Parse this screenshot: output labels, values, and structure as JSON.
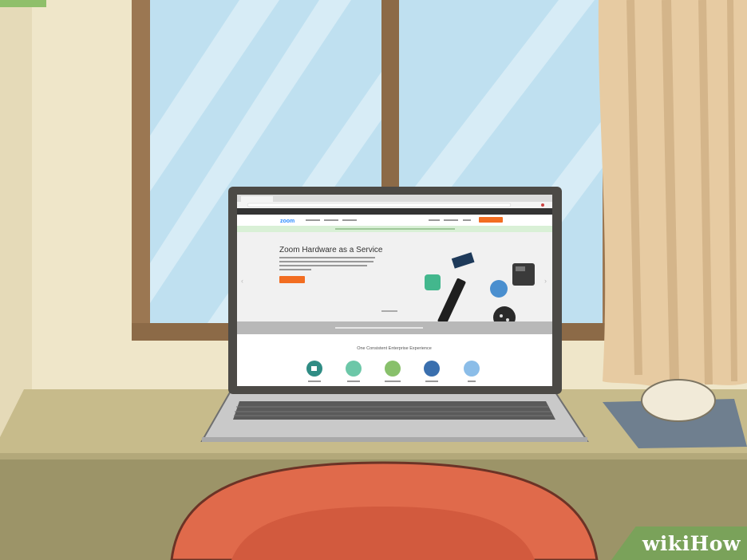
{
  "scene": "laptop-on-desk",
  "colors": {
    "wall": "#efe6c9",
    "window_frame": "#9b7752",
    "glass": "#bfe0f0",
    "curtain": "#e7cba2",
    "desk": "#c7bb8b",
    "desk_front": "#9c9468",
    "chair": "#e06a4b",
    "laptop_body": "#c9c9c9",
    "bezel": "#4c4a46",
    "zoom_blue": "#2d8cff",
    "cta_orange": "#f26d21"
  },
  "browser": {
    "zoom_logo": "zoom",
    "hero_title": "Zoom Hardware as a Service",
    "section_title": "One Consistent Enterprise Experience",
    "product_icons": [
      "video-camera-icon",
      "meeting-rooms-icon",
      "conference-room-icon",
      "phone-icon",
      "chat-icon"
    ]
  },
  "watermark": {
    "wiki": "wiki",
    "how": "How"
  }
}
